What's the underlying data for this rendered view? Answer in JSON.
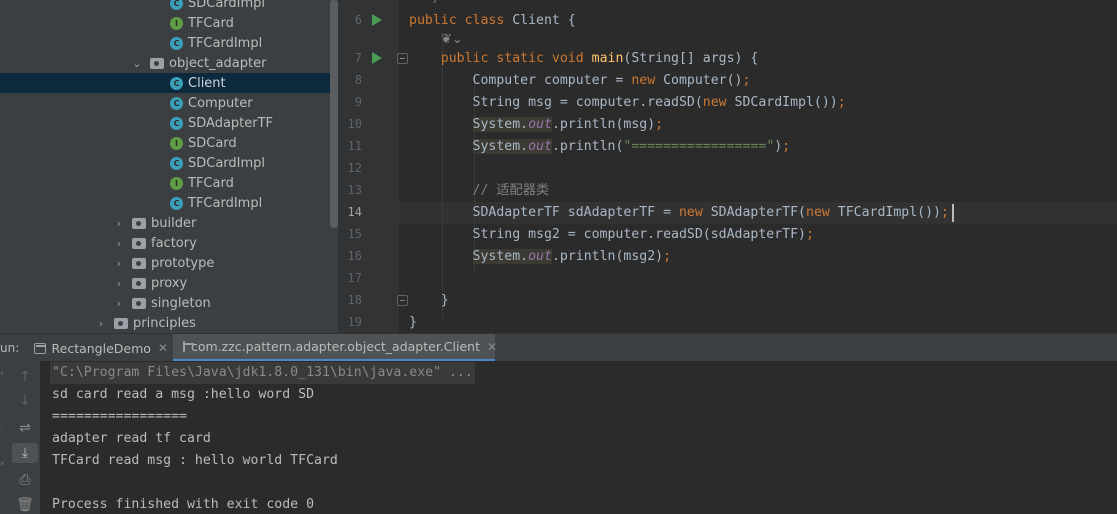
{
  "tree": {
    "items": [
      {
        "label": "SDCardImpl",
        "kind": "class"
      },
      {
        "label": "TFCard",
        "kind": "interface"
      },
      {
        "label": "TFCardImpl",
        "kind": "class"
      },
      {
        "label": "object_adapter",
        "kind": "package",
        "expanded": true
      },
      {
        "label": "Client",
        "kind": "class",
        "selected": true
      },
      {
        "label": "Computer",
        "kind": "class"
      },
      {
        "label": "SDAdapterTF",
        "kind": "class"
      },
      {
        "label": "SDCard",
        "kind": "interface"
      },
      {
        "label": "SDCardImpl",
        "kind": "class"
      },
      {
        "label": "TFCard",
        "kind": "interface"
      },
      {
        "label": "TFCardImpl",
        "kind": "class"
      },
      {
        "label": "builder",
        "kind": "package",
        "expanded": false
      },
      {
        "label": "factory",
        "kind": "package",
        "expanded": false
      },
      {
        "label": "prototype",
        "kind": "package",
        "expanded": false
      },
      {
        "label": "proxy",
        "kind": "package",
        "expanded": false
      },
      {
        "label": "singleton",
        "kind": "package",
        "expanded": false
      },
      {
        "label": "principles",
        "kind": "package",
        "expanded": false
      }
    ]
  },
  "editor": {
    "line_numbers": [
      "6",
      "7",
      "8",
      "9",
      "10",
      "11",
      "12",
      "13",
      "14",
      "15",
      "16",
      "17",
      "18",
      "19"
    ],
    "current_line": "14",
    "comment_text": "// 适配器类",
    "close_inner": "}",
    "close_outer": "}"
  },
  "run": {
    "title": "un:",
    "tabs": [
      {
        "label": "RectangleDemo"
      },
      {
        "label": "com.zzc.pattern.adapter.object_adapter.Client"
      }
    ],
    "console_lines": [
      "\"C:\\Program Files\\Java\\jdk1.8.0_131\\bin\\java.exe\" ...",
      "sd card read a msg :hello word SD",
      "=================",
      "adapter read tf card",
      "TFCard read msg : hello world TFCard",
      "",
      "Process finished with exit code 0"
    ]
  },
  "colors": {
    "keyword": "#cc7832",
    "method": "#ffc66d",
    "string": "#6a8759",
    "field": "#9876aa",
    "selection": "#0d293e",
    "run_icon": "#499c54"
  }
}
